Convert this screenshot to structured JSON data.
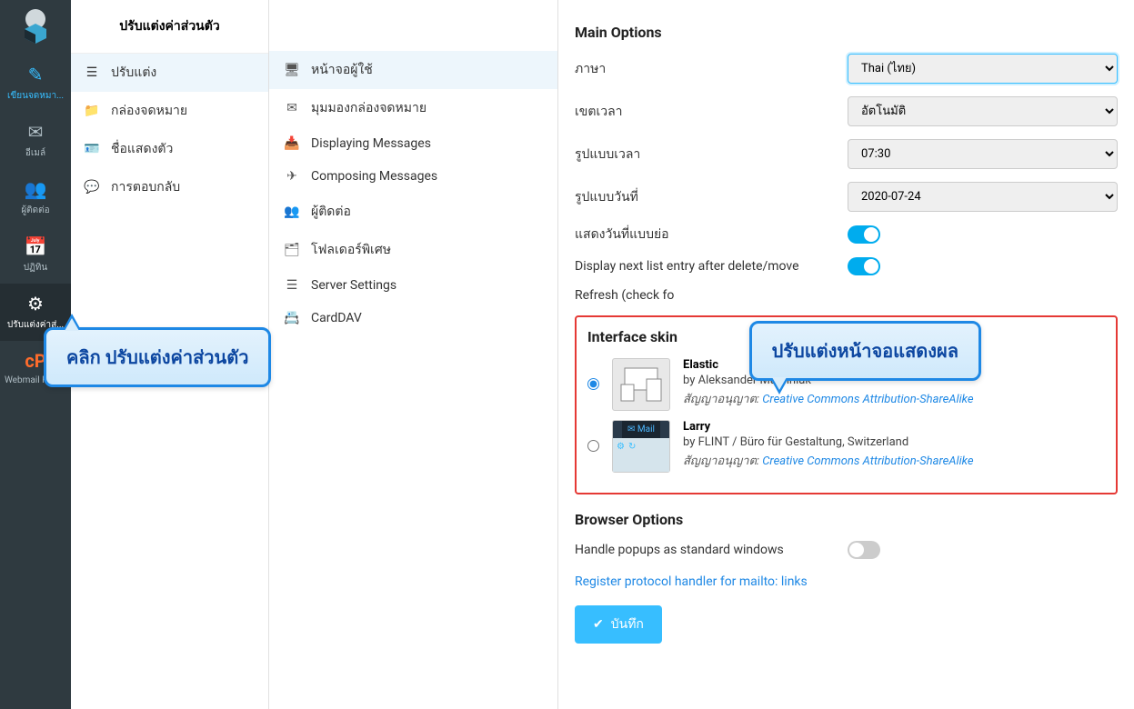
{
  "sidebar_dark": {
    "items": [
      {
        "label": "เขียนจดหมา...",
        "icon": "compose"
      },
      {
        "label": "อีเมล์",
        "icon": "mail"
      },
      {
        "label": "ผู้ติดต่อ",
        "icon": "contacts"
      },
      {
        "label": "ปฏิทิน",
        "icon": "calendar"
      },
      {
        "label": "ปรับแต่งค่าส่...",
        "icon": "gear"
      },
      {
        "label": "Webmail Home",
        "icon": "cpanel"
      }
    ]
  },
  "sidebar_sections": {
    "title": "ปรับแต่งค่าส่วนตัว",
    "items": [
      {
        "label": "ปรับแต่ง",
        "icon": "sliders"
      },
      {
        "label": "กล่องจดหมาย",
        "icon": "folder"
      },
      {
        "label": "ชื่อแสดงตัว",
        "icon": "id"
      },
      {
        "label": "การตอบกลับ",
        "icon": "reply"
      }
    ]
  },
  "sidebar_settings": {
    "items": [
      {
        "label": "หน้าจอผู้ใช้",
        "icon": "desktop"
      },
      {
        "label": "มุมมองกล่องจดหมาย",
        "icon": "envelope"
      },
      {
        "label": "Displaying Messages",
        "icon": "inbox"
      },
      {
        "label": "Composing Messages",
        "icon": "send"
      },
      {
        "label": "ผู้ติดต่อ",
        "icon": "users"
      },
      {
        "label": "โฟลเดอร์พิเศษ",
        "icon": "folder-open"
      },
      {
        "label": "Server Settings",
        "icon": "server"
      },
      {
        "label": "CardDAV",
        "icon": "carddav"
      }
    ]
  },
  "main": {
    "section_main": "Main Options",
    "fields": {
      "language": {
        "label": "ภาษา",
        "value": "Thai (ไทย)"
      },
      "timezone": {
        "label": "เขตเวลา",
        "value": "อัตโนมัติ"
      },
      "timeformat": {
        "label": "รูปแบบเวลา",
        "value": "07:30"
      },
      "dateformat": {
        "label": "รูปแบบวันที่",
        "value": "2020-07-24"
      },
      "prettydate": {
        "label": "แสดงวันที่แบบย่อ",
        "on": true
      },
      "displaynext": {
        "label": "Display next list entry after delete/move",
        "on": true
      },
      "refresh": {
        "label": "Refresh (check fo"
      }
    },
    "section_skin": "Interface skin",
    "skins": [
      {
        "name": "Elastic",
        "author": "by Aleksander Machniak",
        "license_prefix": "สัญญาอนุญาต: ",
        "license": "Creative Commons Attribution-ShareAlike",
        "selected": true
      },
      {
        "name": "Larry",
        "author": "by FLINT / Büro für Gestaltung, Switzerland",
        "license_prefix": "สัญญาอนุญาต: ",
        "license": "Creative Commons Attribution-ShareAlike",
        "selected": false
      }
    ],
    "section_browser": "Browser Options",
    "browser_popup": {
      "label": "Handle popups as standard windows",
      "on": false
    },
    "mailto_link": "Register protocol handler for mailto: links",
    "save_button": "บันทึก"
  },
  "callouts": {
    "c1": "คลิก ปรับแต่งค่าส่วนตัว",
    "c2": "ปรับแต่งหน้าจอแสดงผล"
  }
}
